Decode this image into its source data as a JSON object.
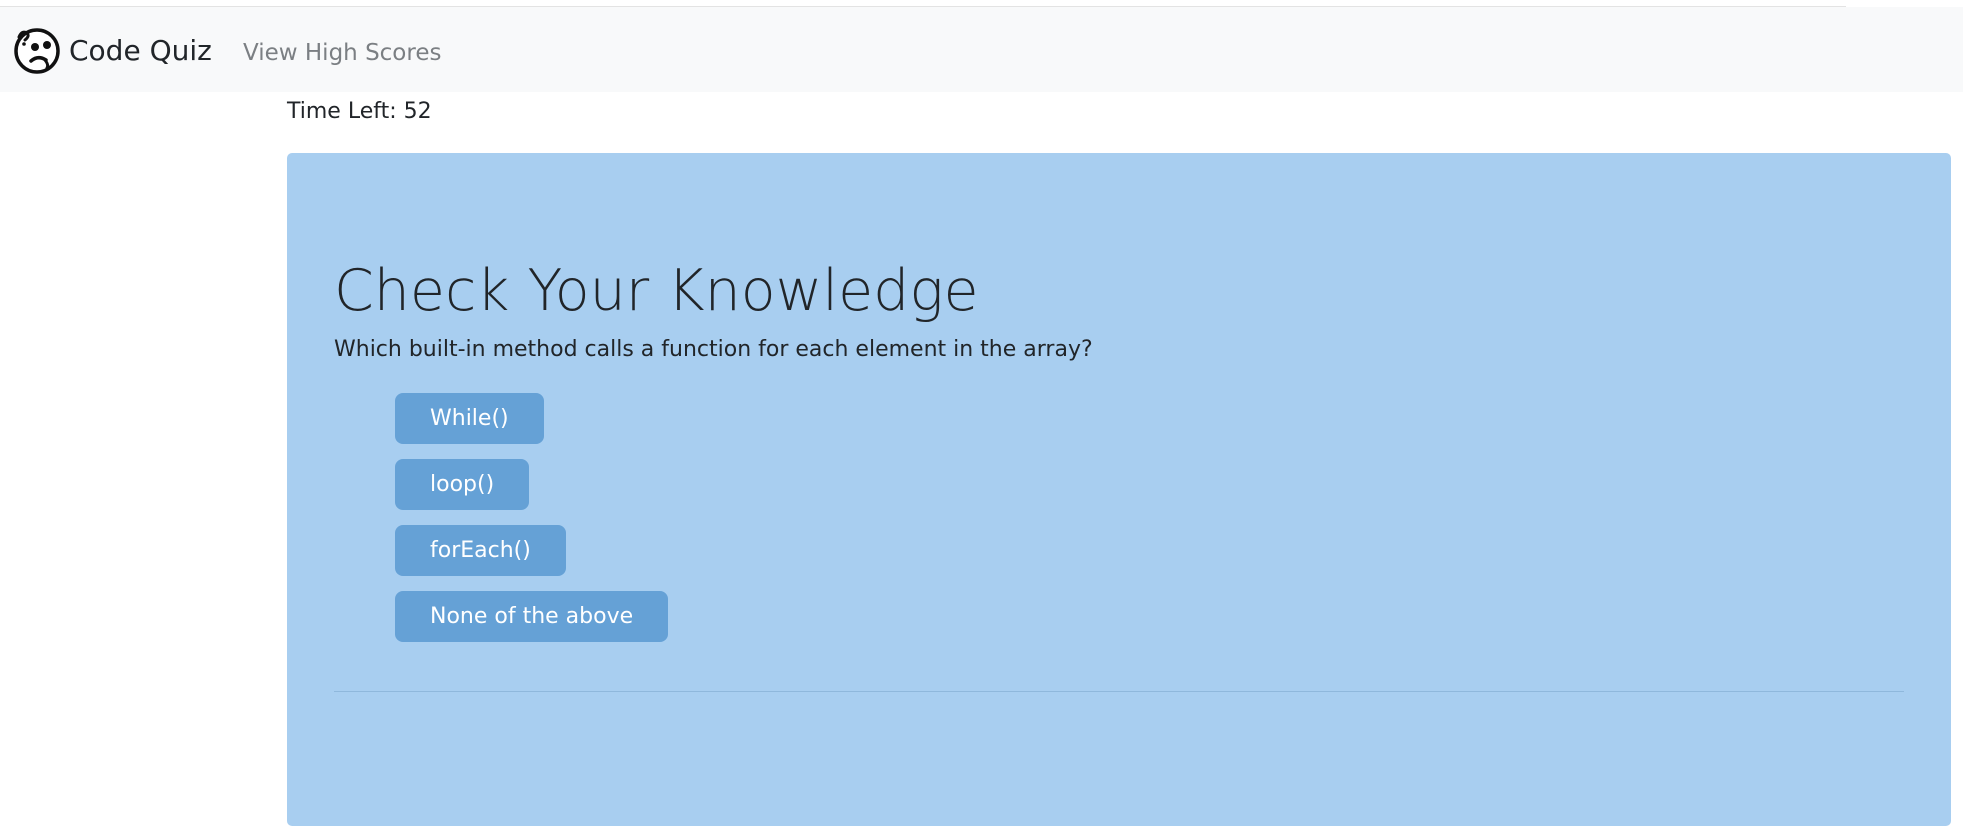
{
  "navbar": {
    "brand_label": "Code Quiz",
    "brand_icon": "confused-face-icon",
    "high_scores_link": "View High Scores"
  },
  "timer": {
    "text": "Time Left: 52"
  },
  "quiz": {
    "title": "Check Your Knowledge",
    "question": "Which built-in method calls a function for each element in the array?",
    "answers": [
      {
        "label": "While()"
      },
      {
        "label": "loop()"
      },
      {
        "label": "forEach()"
      },
      {
        "label": "None of the above"
      }
    ]
  },
  "colors": {
    "navbar_bg": "#f8f9fa",
    "jumbotron_bg": "#a8cef0",
    "answer_button_bg": "#65a1d6",
    "answer_button_text": "#ffffff",
    "muted_link": "#7b7f83"
  }
}
